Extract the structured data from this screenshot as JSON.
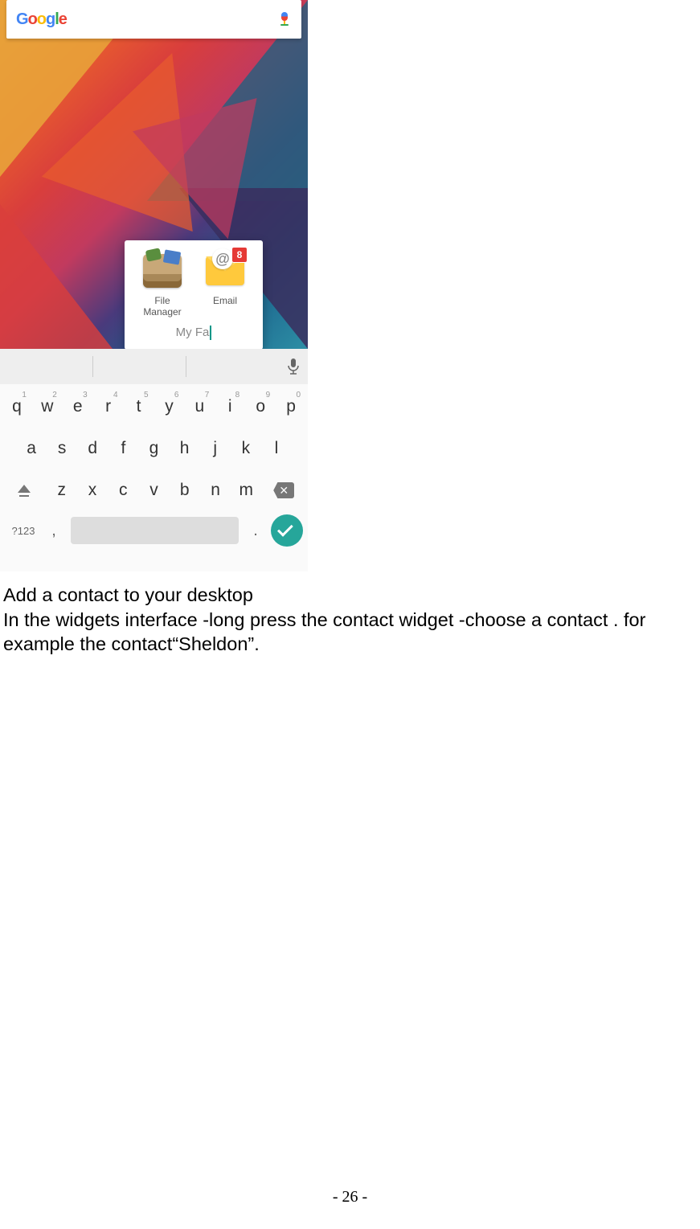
{
  "search": {
    "logo_chars": [
      "G",
      "o",
      "o",
      "g",
      "l",
      "e"
    ]
  },
  "folder": {
    "apps": [
      {
        "label": "File Manager",
        "icon": "file-manager"
      },
      {
        "label": "Email",
        "icon": "email",
        "badge": "8"
      }
    ],
    "name_typed": "My Fa"
  },
  "keyboard": {
    "row1": [
      {
        "k": "q",
        "n": "1"
      },
      {
        "k": "w",
        "n": "2"
      },
      {
        "k": "e",
        "n": "3"
      },
      {
        "k": "r",
        "n": "4"
      },
      {
        "k": "t",
        "n": "5"
      },
      {
        "k": "y",
        "n": "6"
      },
      {
        "k": "u",
        "n": "7"
      },
      {
        "k": "i",
        "n": "8"
      },
      {
        "k": "o",
        "n": "9"
      },
      {
        "k": "p",
        "n": "0"
      }
    ],
    "row2": [
      "a",
      "s",
      "d",
      "f",
      "g",
      "h",
      "j",
      "k",
      "l"
    ],
    "row3": [
      "z",
      "x",
      "c",
      "v",
      "b",
      "n",
      "m"
    ],
    "sym_key": "?123",
    "comma": ",",
    "period": "."
  },
  "doc": {
    "heading": "Add a contact to your desktop",
    "body": "In the widgets interface -long press the contact widget -choose a contact . for example the contact“Sheldon”.",
    "page_number": "- 26 -"
  }
}
